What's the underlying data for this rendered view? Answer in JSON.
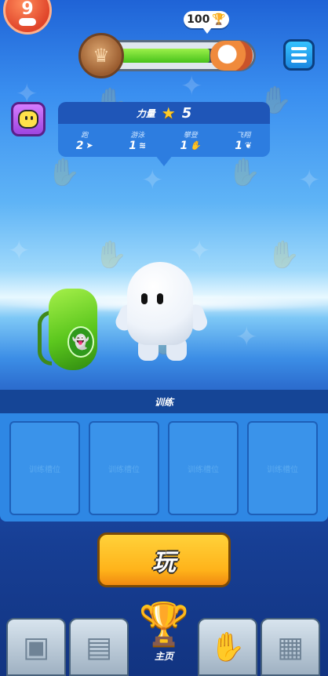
{
  "top_badge": {
    "value": "9",
    "icon": "gamepad-icon"
  },
  "trophy_road": {
    "trophies": "100",
    "trophy_icon": "trophy-icon",
    "progress_fraction": 0.82
  },
  "menu": {
    "icon": "hamburger-icon"
  },
  "emote": {
    "icon": "smiley-emote-icon"
  },
  "stats": {
    "title": "力量",
    "star_value": "5",
    "items": [
      {
        "name": "跑",
        "value": "2",
        "icon": "run-icon"
      },
      {
        "name": "游泳",
        "value": "1",
        "icon": "swim-icon"
      },
      {
        "name": "攀登",
        "value": "1",
        "icon": "climb-icon"
      },
      {
        "name": "飞翔",
        "value": "1",
        "icon": "fly-icon"
      }
    ]
  },
  "training": {
    "title": "训练",
    "slots": [
      "训练槽位",
      "训练槽位",
      "训练槽位",
      "训练槽位"
    ]
  },
  "play_button": {
    "label": "玩"
  },
  "nav": {
    "items": [
      {
        "icon": "costume-icon"
      },
      {
        "icon": "cards-icon"
      },
      {
        "label": "主页",
        "icon": "trophy-icon"
      },
      {
        "icon": "emote-hands-icon"
      },
      {
        "icon": "calendar-icon"
      }
    ]
  },
  "colors": {
    "accent_yellow": "#ffb31a",
    "panel_blue": "#2e87e4",
    "header_blue": "#154596"
  }
}
